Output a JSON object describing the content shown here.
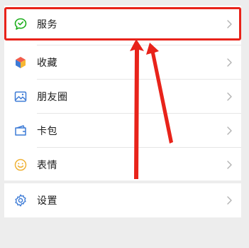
{
  "menu": {
    "items": [
      {
        "label": "服务",
        "icon": "service-chat-icon",
        "color": "#1aad19"
      },
      {
        "label": "收藏",
        "icon": "favorites-cube-icon"
      },
      {
        "label": "朋友圈",
        "icon": "moments-photo-icon",
        "color": "#3d7bd6"
      },
      {
        "label": "卡包",
        "icon": "card-wallet-icon",
        "color": "#3d7bd6"
      },
      {
        "label": "表情",
        "icon": "emoji-smile-icon",
        "color": "#f0b236"
      }
    ],
    "settings": {
      "label": "设置",
      "icon": "settings-gear-icon",
      "color": "#3d7bd6"
    }
  },
  "annotation": {
    "highlight_color": "#e8231a",
    "highlighted_item": "服务",
    "arrow_count": 2
  }
}
